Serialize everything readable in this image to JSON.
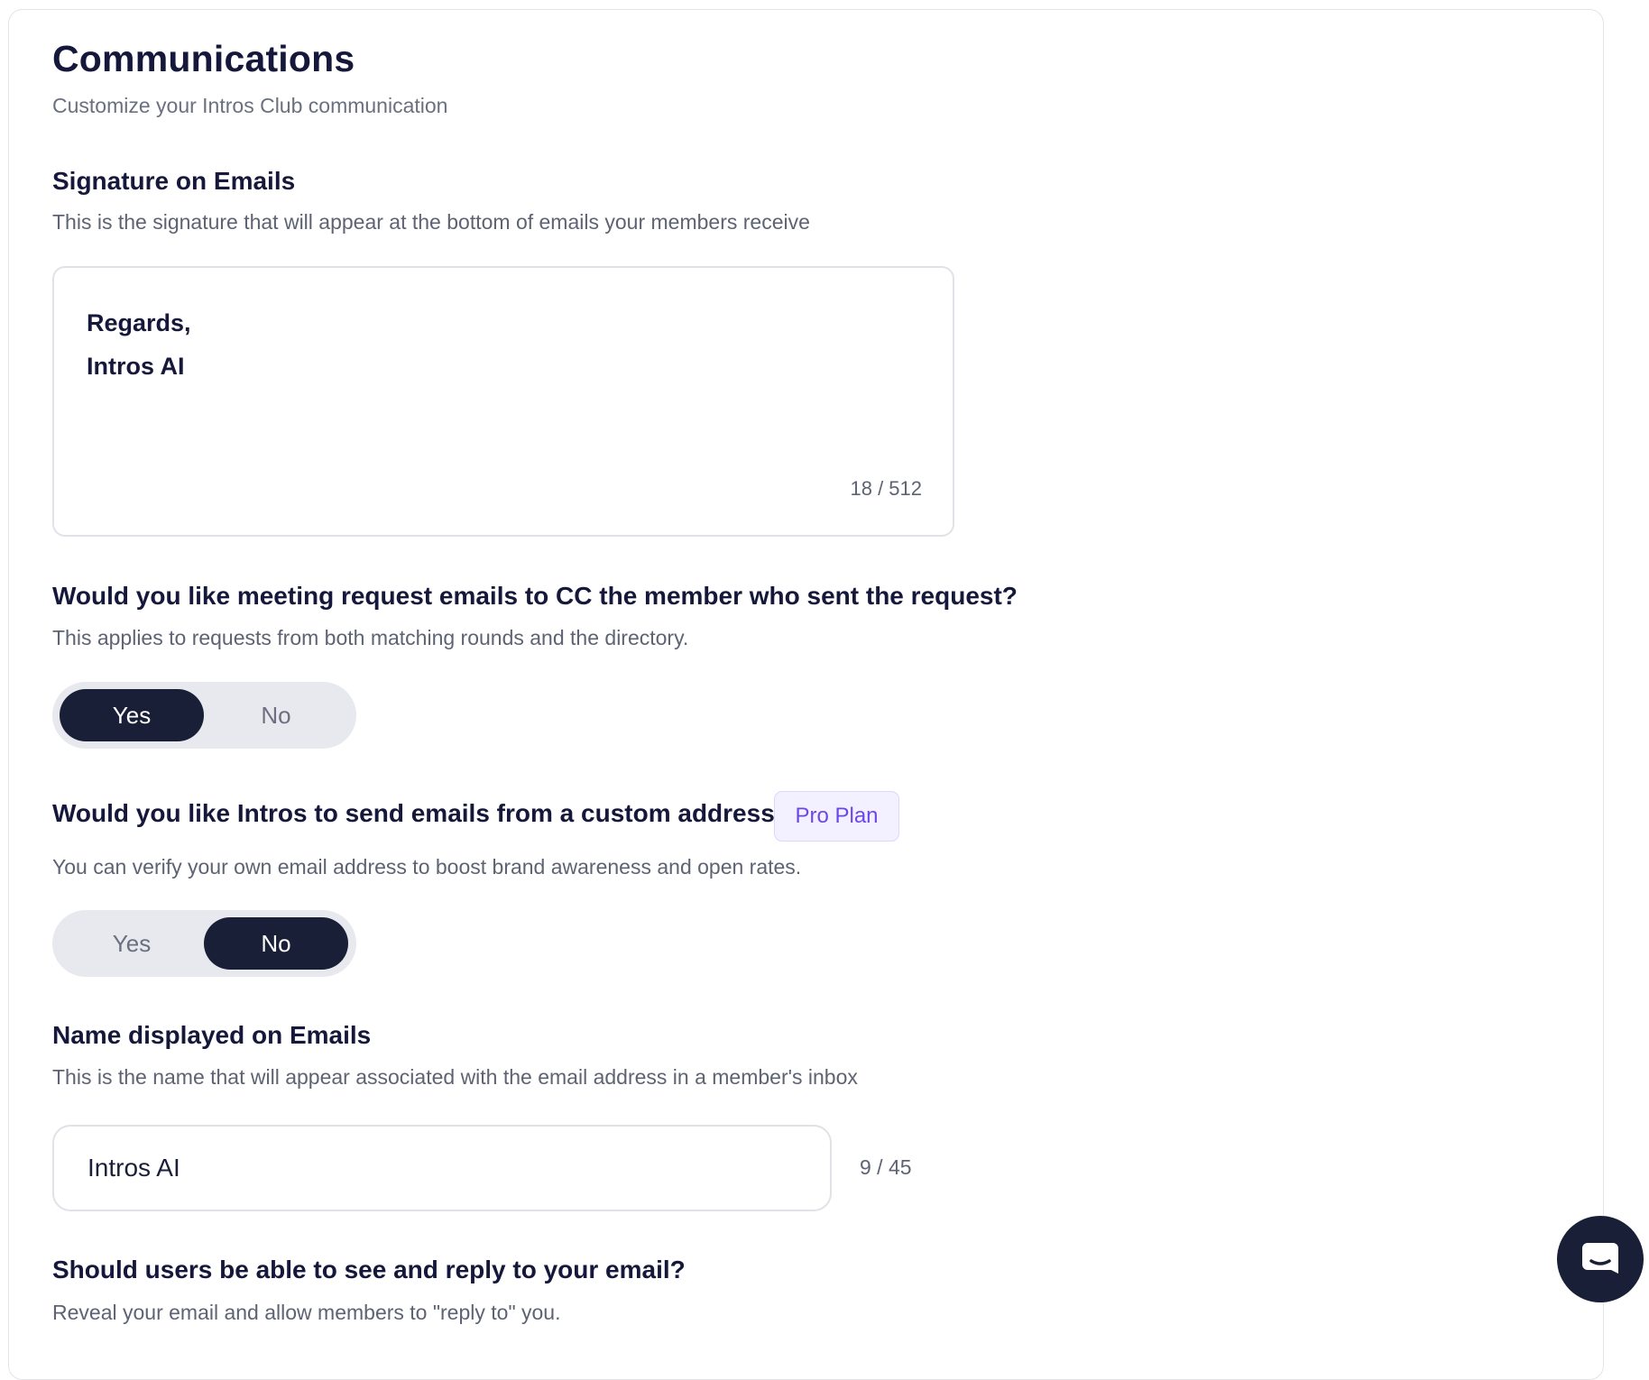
{
  "page": {
    "title": "Communications",
    "subtitle": "Customize your Intros Club communication"
  },
  "signature": {
    "title": "Signature on Emails",
    "description": "This is the signature that will appear at the bottom of emails your members receive",
    "lines": [
      "Regards,",
      "Intros AI"
    ],
    "counter": "18 / 512"
  },
  "cc_setting": {
    "title": "Would you like meeting request emails to CC the member who sent the request?",
    "description": "This applies to requests from both matching rounds and the directory.",
    "options": [
      "Yes",
      "No"
    ],
    "selected": "Yes"
  },
  "custom_address": {
    "title": "Would you like Intros to send emails from a custom address?",
    "badge": "Pro Plan",
    "description": "You can verify your own email address to boost brand awareness and open rates.",
    "options": [
      "Yes",
      "No"
    ],
    "selected": "No"
  },
  "display_name": {
    "title": "Name displayed on Emails",
    "description": "This is the name that will appear associated with the email address in a member's inbox",
    "value": "Intros AI",
    "counter": "9 / 45"
  },
  "reply_setting": {
    "title": "Should users be able to see and reply to your email?",
    "description": "Reveal your email and allow members to \"reply to\" you."
  },
  "chat_widget": {
    "icon": "chat-bubble-icon"
  },
  "colors": {
    "accent_dark": "#1a1f38",
    "badge_text": "#6c47e8",
    "badge_bg": "#f3f1ff"
  }
}
